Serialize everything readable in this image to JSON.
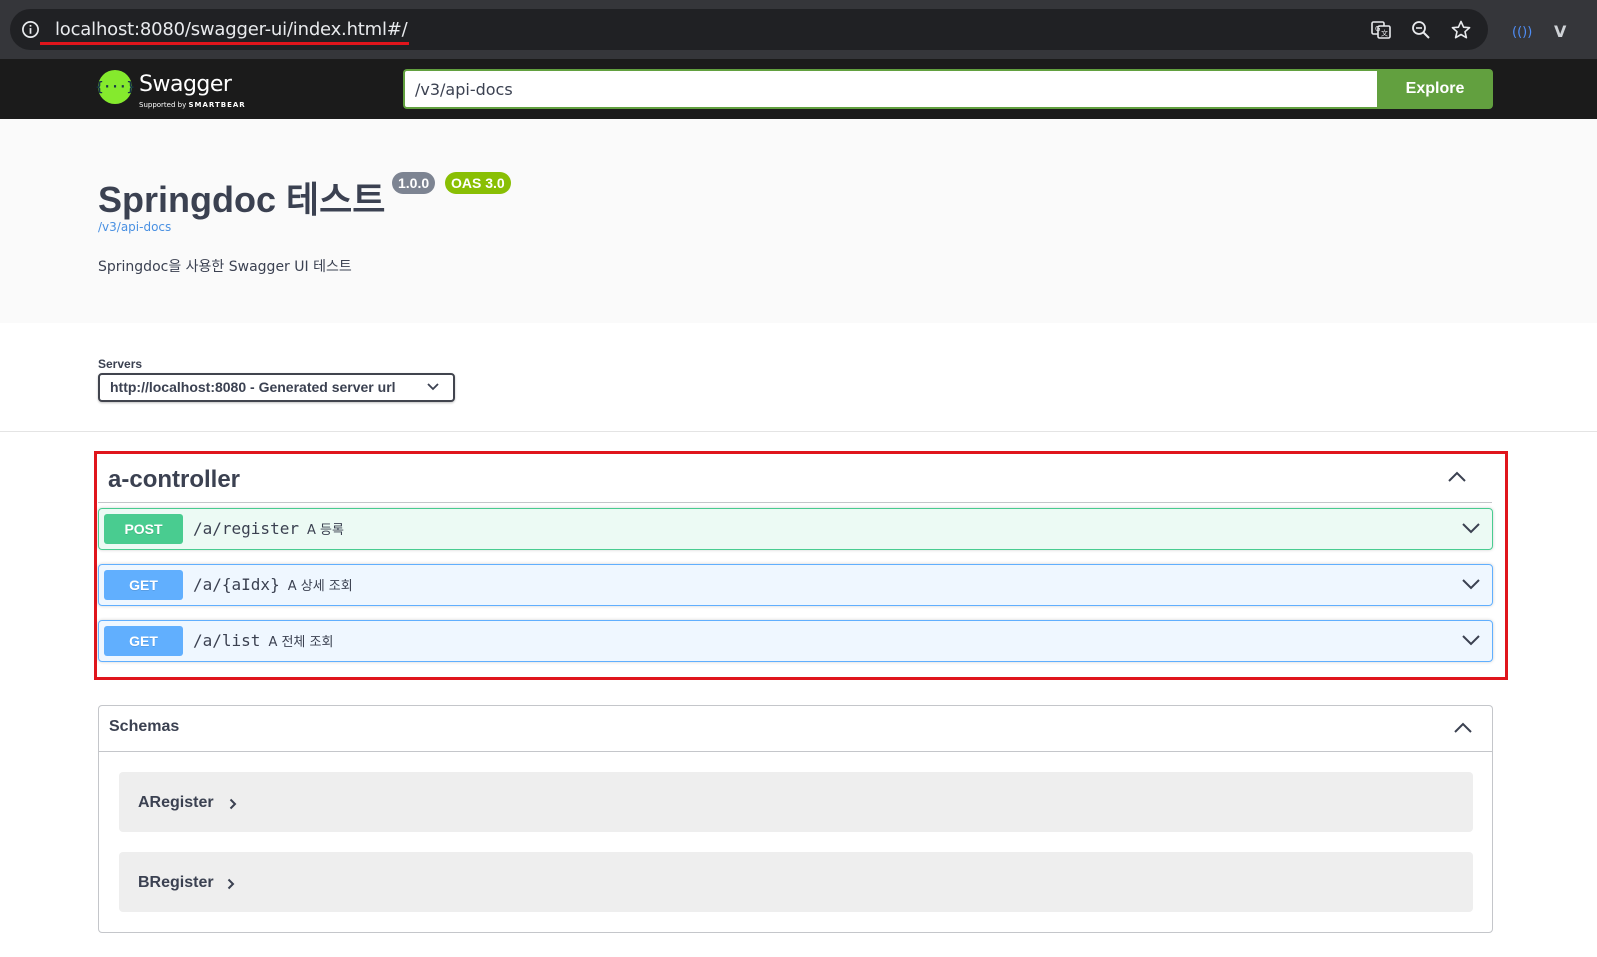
{
  "browser": {
    "url": "localhost:8080/swagger-ui/index.html#/"
  },
  "topbar": {
    "logo_brace": "{···}",
    "logo_text": "Swagger",
    "logo_sub_prefix": "Supported by",
    "logo_sub_brand": "SMARTBEAR",
    "spec_url_value": "/v3/api-docs",
    "explore_label": "Explore"
  },
  "info": {
    "title": "Springdoc 테스트",
    "version_badge": "1.0.0",
    "oas_badge": "OAS 3.0",
    "spec_link": "/v3/api-docs",
    "description": "Springdoc을 사용한 Swagger UI 테스트"
  },
  "servers": {
    "label": "Servers",
    "selected": "http://localhost:8080 - Generated server url"
  },
  "controller": {
    "name": "a-controller",
    "operations": [
      {
        "method": "POST",
        "path": "/a/register",
        "summary": "A 등록"
      },
      {
        "method": "GET",
        "path": "/a/{aIdx}",
        "summary": "A 상세 조회"
      },
      {
        "method": "GET",
        "path": "/a/list",
        "summary": "A 전체 조회"
      }
    ]
  },
  "schemas": {
    "title": "Schemas",
    "models": [
      "ARegister",
      "BRegister"
    ]
  },
  "colors": {
    "highlight": "#e0151c",
    "post": "#49cc90",
    "get": "#61affe",
    "explore": "#62a03f"
  }
}
